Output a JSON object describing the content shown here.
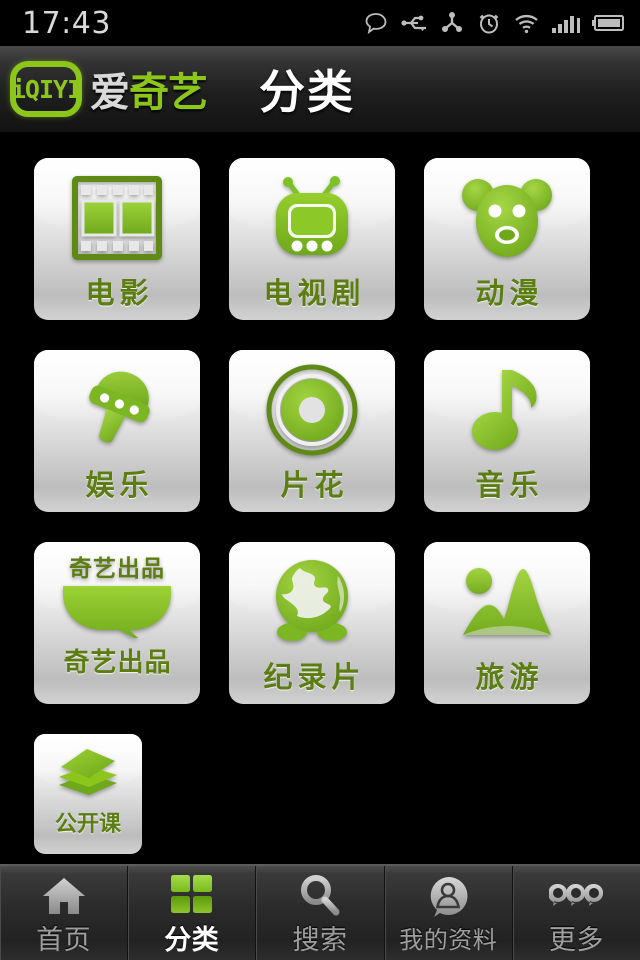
{
  "status_bar": {
    "time": "17:43",
    "icons": [
      "message-bubble-icon",
      "usb-icon",
      "sync-icon",
      "alarm-clock-icon",
      "wifi-icon",
      "signal-bars-icon",
      "battery-icon"
    ]
  },
  "header": {
    "logo_mark_text": "iQIYI",
    "brand_name_white": "爱",
    "brand_name_green": "奇艺",
    "title": "分类"
  },
  "colors": {
    "brand_green": "#8DC61B",
    "icon_green": "#7CC125",
    "icon_green_dark": "#5c7d12",
    "label_green": "#5c7d12",
    "tile_light": "#fdfdfd",
    "tile_dark": "#bdbdbd",
    "bar_gray": "#9e9e9e",
    "active_white": "#ffffff",
    "background": "#000000"
  },
  "grid": {
    "tiles": [
      {
        "label": "电影",
        "icon": "film-strip-icon"
      },
      {
        "label": "电视剧",
        "icon": "television-icon"
      },
      {
        "label": "动漫",
        "icon": "bear-face-icon"
      },
      {
        "label": "娱乐",
        "icon": "microphone-icon"
      },
      {
        "label": "片花",
        "icon": "disc-icon"
      },
      {
        "label": "音乐",
        "icon": "music-note-icon"
      },
      {
        "label": "奇艺出品",
        "icon": "speech-bubble-icon",
        "icon_text": "奇艺出品"
      },
      {
        "label": "纪录片",
        "icon": "globe-icon"
      },
      {
        "label": "旅游",
        "icon": "mountains-icon"
      },
      {
        "label": "公开课",
        "icon": "books-stack-icon"
      }
    ]
  },
  "tabbar": {
    "tabs": [
      {
        "label": "首页",
        "icon": "home-icon",
        "active": false
      },
      {
        "label": "分类",
        "icon": "grid-icon",
        "active": true
      },
      {
        "label": "搜索",
        "icon": "search-icon",
        "active": false
      },
      {
        "label": "我的资料",
        "icon": "person-icon",
        "active": false
      },
      {
        "label": "更多",
        "icon": "more-dots-icon",
        "active": false
      }
    ]
  }
}
